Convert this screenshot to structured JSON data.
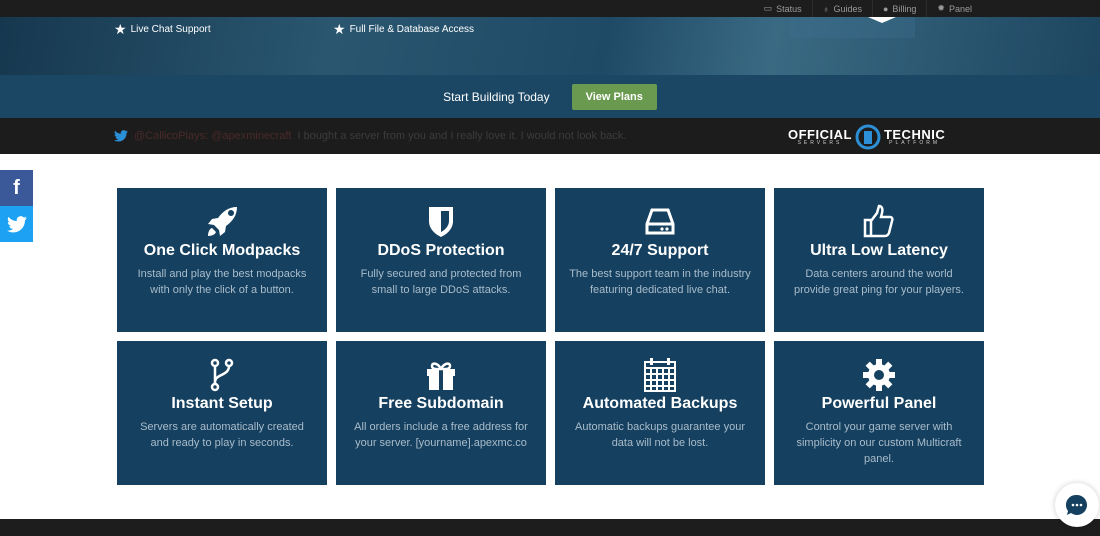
{
  "topnav": [
    {
      "label": "Status",
      "icon": "hdd-icon"
    },
    {
      "label": "Guides",
      "icon": "lightbulb-icon"
    },
    {
      "label": "Billing",
      "icon": "user-icon"
    },
    {
      "label": "Panel",
      "icon": "gear-icon"
    }
  ],
  "hero": {
    "features": [
      "Live Chat Support",
      "Full File & Database Access"
    ]
  },
  "cta": {
    "text": "Start Building Today",
    "button": "View Plans"
  },
  "tweet": {
    "handle": "@CallicoPlays: @apexminecraft",
    "text": "I bought a server from you and I really love it. I would not look back."
  },
  "partner": {
    "line1a": "OFFICIAL",
    "line1b": "SERVERS",
    "line2a": "TECHNIC",
    "line2b": "PLATFORM"
  },
  "social": {
    "facebook": "f",
    "twitter": "twitter-icon"
  },
  "features": [
    {
      "icon": "rocket-icon",
      "title": "One Click Modpacks",
      "desc": "Install and play the best modpacks with only the click of a button."
    },
    {
      "icon": "shield-icon",
      "title": "DDoS Protection",
      "desc": "Fully secured and protected from small to large DDoS attacks."
    },
    {
      "icon": "hdd-icon",
      "title": "24/7 Support",
      "desc": "The best support team in the industry featuring dedicated live chat."
    },
    {
      "icon": "thumbs-up-icon",
      "title": "Ultra Low Latency",
      "desc": "Data centers around the world provide great ping for your players."
    },
    {
      "icon": "code-fork-icon",
      "title": "Instant Setup",
      "desc": "Servers are automatically created and ready to play in seconds."
    },
    {
      "icon": "gift-icon",
      "title": "Free Subdomain",
      "desc": "All orders include a free address for your server. [yourname].apexmc.co"
    },
    {
      "icon": "calendar-icon",
      "title": "Automated Backups",
      "desc": "Automatic backups guarantee your data will not be lost."
    },
    {
      "icon": "gear-icon",
      "title": "Powerful Panel",
      "desc": "Control your game server with simplicity on our custom Multicraft panel."
    }
  ],
  "colors": {
    "card": "#15405f",
    "cta_button": "#6a9a4f",
    "band": "#1b4764",
    "facebook": "#3b5998",
    "twitter": "#1da1f2"
  }
}
